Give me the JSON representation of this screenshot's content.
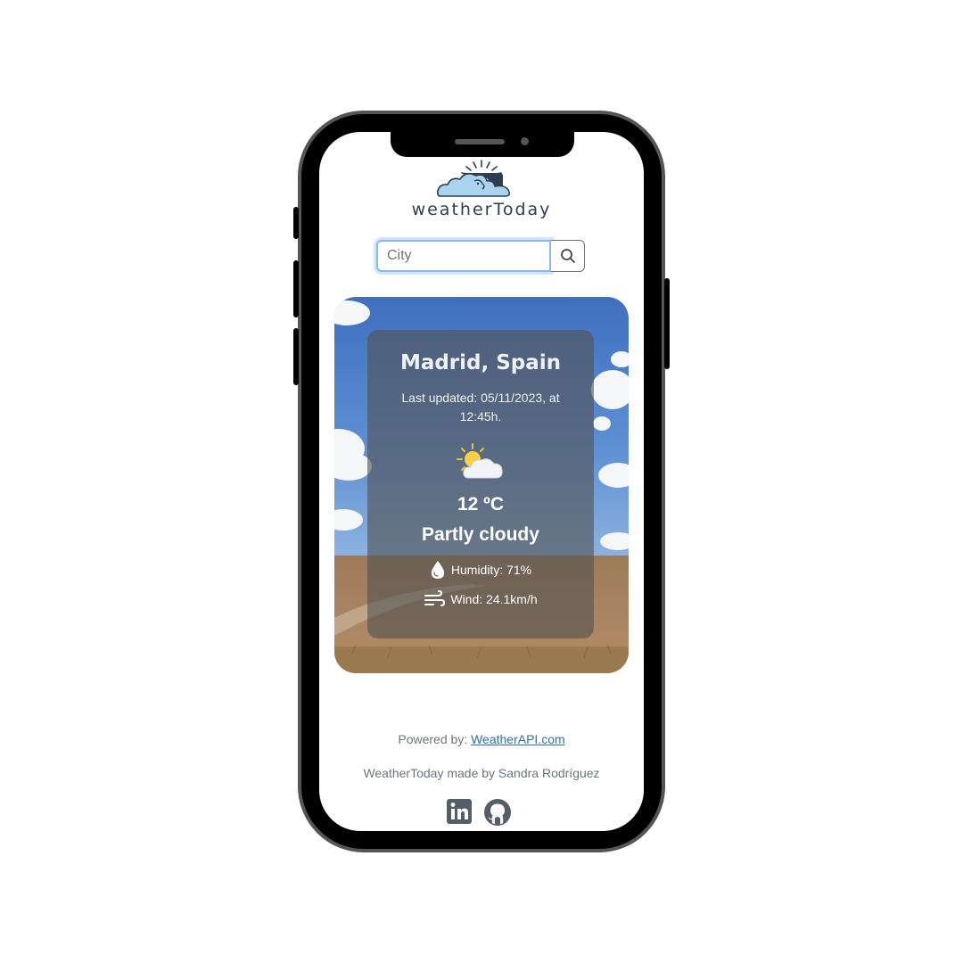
{
  "app": {
    "brand": "WeatherToday",
    "brand_display": "weatherToday"
  },
  "search": {
    "placeholder": "City",
    "value": ""
  },
  "weather": {
    "location": "Madrid, Spain",
    "last_updated": "Last updated: 05/11/2023, at 12:45h.",
    "condition_icon": "sun-behind-cloud-icon",
    "temperature": "12 ºC",
    "condition": "Partly cloudy",
    "humidity": "Humidity: 71%",
    "wind": "Wind: 24.1km/h"
  },
  "footer": {
    "powered_label": "Powered by: ",
    "powered_link": "WeatherAPI.com",
    "made_by": "WeatherToday made by Sandra Rodríguez",
    "social_icons": [
      "linkedin-icon",
      "github-icon"
    ]
  },
  "colors": {
    "brand_text": "#2e3d52",
    "link": "#2f6fb6",
    "focus_border": "#86b7fe",
    "overlay": "#525252"
  }
}
